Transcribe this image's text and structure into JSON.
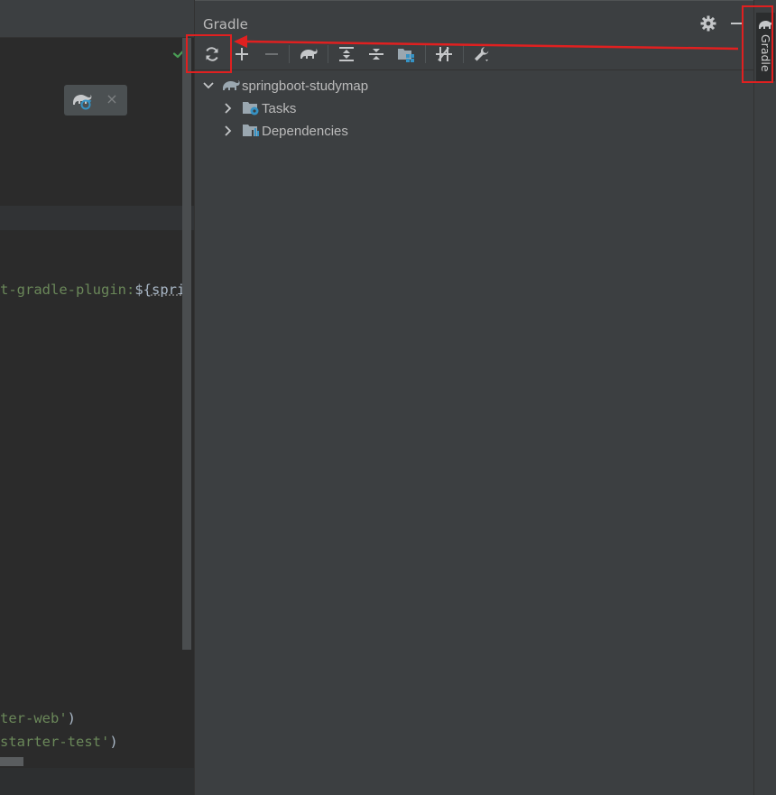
{
  "editor": {
    "code_lines": [
      {
        "parts": [
          {
            "cls": "s",
            "text": "t-gradle-plugin:"
          },
          {
            "cls": "t",
            "text": "${"
          },
          {
            "cls": "u",
            "text": "spri"
          }
        ]
      },
      {
        "parts": [
          {
            "cls": "s",
            "text": "ter-web'"
          },
          {
            "cls": "t",
            "text": ")"
          }
        ]
      },
      {
        "parts": [
          {
            "cls": "s",
            "text": "starter-test'"
          },
          {
            "cls": "t",
            "text": ")"
          }
        ]
      }
    ],
    "popup_close": "×",
    "check_color": "#499c54"
  },
  "gradle": {
    "title": "Gradle",
    "toolbar": [
      {
        "name": "reload-all-gradle-projects-button",
        "icon": "refresh-icon"
      },
      {
        "name": "add-gradle-project-button",
        "icon": "plus-icon"
      },
      {
        "name": "unlink-gradle-project-button",
        "icon": "minus-icon"
      },
      {
        "name": "execute-gradle-task-button",
        "icon": "gradle-elephant-icon"
      },
      {
        "name": "expand-all-button",
        "icon": "expand-all-icon"
      },
      {
        "name": "collapse-all-button",
        "icon": "collapse-all-icon"
      },
      {
        "name": "analyze-dependencies-button",
        "icon": "dependency-analyzer-icon"
      },
      {
        "name": "toggle-offline-mode-button",
        "icon": "offline-mode-icon"
      },
      {
        "name": "build-tool-settings-button",
        "icon": "wrench-icon"
      }
    ],
    "tree": {
      "project": "springboot-studymap",
      "children": [
        "Tasks",
        "Dependencies"
      ]
    }
  },
  "right_strip": {
    "tab_label": "Gradle"
  },
  "colors": {
    "annotation": "#e02020",
    "panel_bg": "#3c3f41",
    "editor_bg": "#2b2b2b",
    "accent_blue": "#3592c4"
  }
}
